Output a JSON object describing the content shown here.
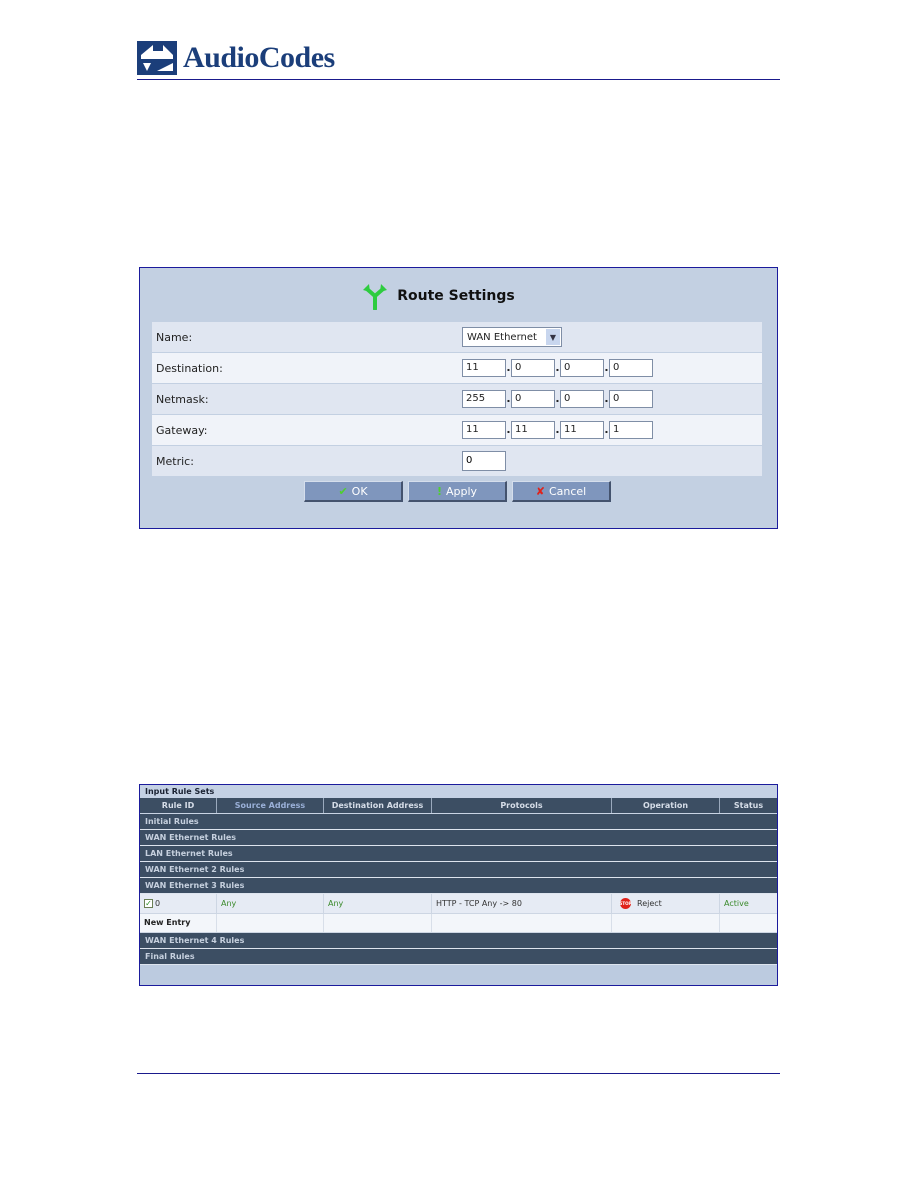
{
  "header": {
    "brand": "AudioCodes",
    "brand_color": "#1b3e7a",
    "rule_color": "#1a1a8c"
  },
  "route_settings": {
    "title": "Route Settings",
    "title_icon": "route-split-arrow-icon",
    "fields": {
      "name": {
        "label": "Name:",
        "value": "WAN Ethernet"
      },
      "destination": {
        "label": "Destination:",
        "octets": [
          "11",
          "0",
          "0",
          "0"
        ]
      },
      "netmask": {
        "label": "Netmask:",
        "octets": [
          "255",
          "0",
          "0",
          "0"
        ]
      },
      "gateway": {
        "label": "Gateway:",
        "octets": [
          "11",
          "11",
          "11",
          "1"
        ]
      },
      "metric": {
        "label": "Metric:",
        "value": "0"
      }
    },
    "buttons": {
      "ok": {
        "label": "OK",
        "icon": "checkmark-icon"
      },
      "apply": {
        "label": "Apply",
        "icon": "exclamation-icon"
      },
      "cancel": {
        "label": "Cancel",
        "icon": "x-icon"
      }
    }
  },
  "rules": {
    "title": "Input Rule Sets",
    "columns": [
      "Rule ID",
      "Source Address",
      "Destination Address",
      "Protocols",
      "Operation",
      "Status"
    ],
    "groups": {
      "initial": "Initial Rules",
      "wan": "WAN Ethernet Rules",
      "lan": "LAN Ethernet Rules",
      "wan2": "WAN Ethernet 2 Rules",
      "wan3": "WAN Ethernet 3 Rules",
      "wan4": "WAN Ethernet 4 Rules",
      "final": "Final Rules"
    },
    "wan3_rows": [
      {
        "rule_id": "0",
        "checked": true,
        "source": "Any",
        "destination": "Any",
        "protocols": "HTTP - TCP Any -> 80",
        "operation": "Reject",
        "status": "Active"
      }
    ],
    "new_entry": "New Entry"
  }
}
